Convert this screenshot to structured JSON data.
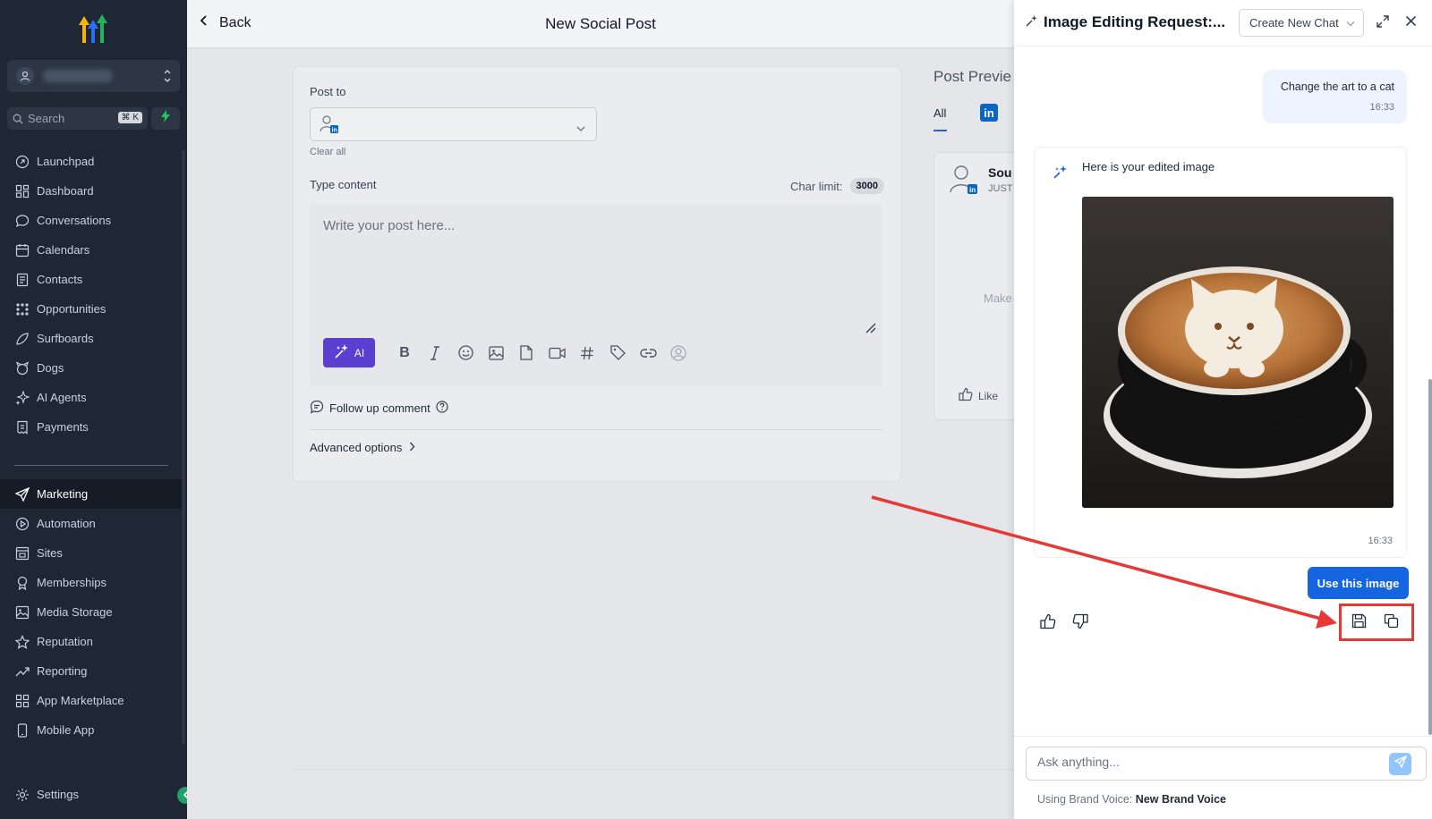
{
  "sidebar": {
    "search_placeholder": "Search",
    "search_shortcut": "⌘ K",
    "items": [
      {
        "label": "Launchpad"
      },
      {
        "label": "Dashboard"
      },
      {
        "label": "Conversations"
      },
      {
        "label": "Calendars"
      },
      {
        "label": "Contacts"
      },
      {
        "label": "Opportunities"
      },
      {
        "label": "Surfboards"
      },
      {
        "label": "Dogs"
      },
      {
        "label": "AI Agents"
      },
      {
        "label": "Payments"
      },
      {
        "label": "Marketing"
      },
      {
        "label": "Automation"
      },
      {
        "label": "Sites"
      },
      {
        "label": "Memberships"
      },
      {
        "label": "Media Storage"
      },
      {
        "label": "Reputation"
      },
      {
        "label": "Reporting"
      },
      {
        "label": "App Marketplace"
      },
      {
        "label": "Mobile App"
      },
      {
        "label": "Settings"
      }
    ],
    "active_item": "Marketing"
  },
  "header": {
    "back_label": "Back",
    "title": "New Social Post"
  },
  "composer": {
    "post_to_label": "Post to",
    "clear_all": "Clear all",
    "type_content_label": "Type content",
    "char_limit_label": "Char limit:",
    "char_limit_value": "3000",
    "placeholder": "Write your post here...",
    "ai_label": "AI",
    "follow_up_label": "Follow up comment",
    "advanced_label": "Advanced options"
  },
  "preview": {
    "title": "Post Previe",
    "tab_all": "All",
    "tab_linkedin": "in",
    "name": "Sou",
    "time": "JUST",
    "body": "Make",
    "like": "Like"
  },
  "panel": {
    "title": "Image Editing Request:...",
    "new_chat_label": "Create New Chat",
    "user_message": "Change the art to a cat",
    "user_time": "16:33",
    "bot_message": "Here is your edited image",
    "bot_time": "16:33",
    "use_image_label": "Use this image",
    "ask_placeholder": "Ask anything...",
    "brand_voice_prefix": "Using Brand Voice:",
    "brand_voice_value": "New Brand Voice"
  },
  "colors": {
    "sidebar_bg": "#1e2733",
    "accent_blue": "#1565e0",
    "ai_purple": "#5b3fd1",
    "highlight_red": "#e53935"
  }
}
